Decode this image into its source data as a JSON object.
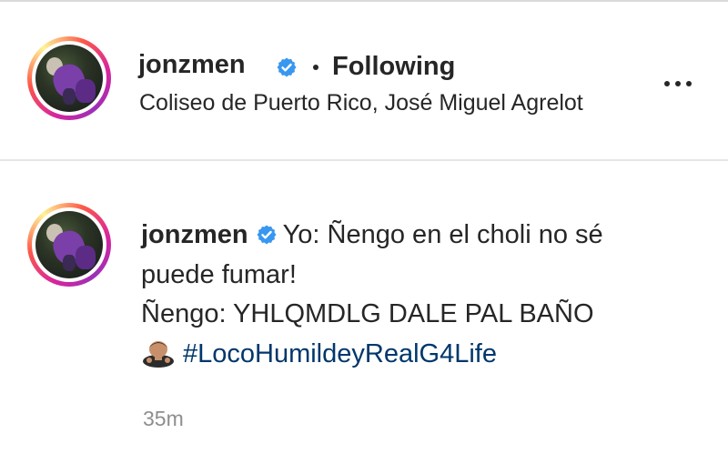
{
  "post": {
    "username": "jonzmen",
    "separator": "•",
    "follow_status": "Following",
    "location": "Coliseo de Puerto Rico, José Miguel Agrelot",
    "more_icon": "more-horizontal-icon"
  },
  "comment": {
    "username": "jonzmen",
    "line1": "Yo: Ñengo en el choli no sé",
    "line2": "puede fumar!",
    "line3": "Ñengo: YHLQMDLG DALE PAL BAÑO",
    "emoji": "man-bowing-emoji",
    "hashtag": "#LocoHumildeyRealG4Life",
    "timestamp": "35m"
  },
  "colors": {
    "text": "#262626",
    "secondary": "#8e8e8e",
    "verified": "#3897f0",
    "hashtag": "#00376b"
  }
}
